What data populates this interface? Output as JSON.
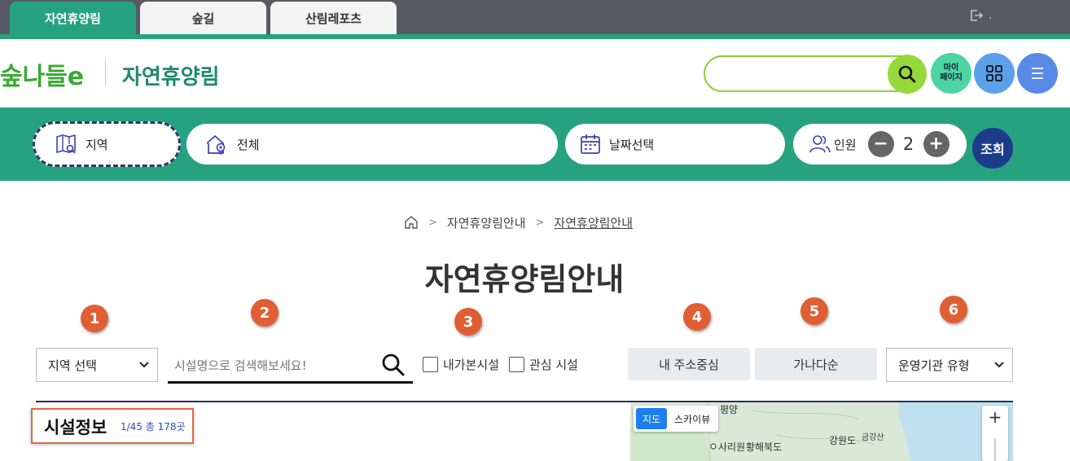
{
  "topbar": {
    "tabs": [
      {
        "label": "자연휴양림",
        "active": true
      },
      {
        "label": "숲길",
        "active": false
      },
      {
        "label": "산림레포츠",
        "active": false
      }
    ],
    "logout_text": "."
  },
  "header": {
    "logo_text": "숲나들e",
    "site_title": "자연휴양림",
    "search_placeholder": "",
    "mypage_line1": "마이",
    "mypage_line2": "페이지"
  },
  "filter": {
    "region_label": "지역",
    "all_label": "전체",
    "date_label": "날짜선택",
    "people_label": "인원",
    "people_count": "2",
    "minus": "−",
    "plus": "+",
    "query_label": "조회"
  },
  "breadcrumb": {
    "items": [
      "자연휴양림안내",
      "자연휴양림안내"
    ]
  },
  "page_title": "자연휴양림안내",
  "markers": [
    "1",
    "2",
    "3",
    "4",
    "5",
    "6"
  ],
  "controls": {
    "region_select": "지역 선택",
    "name_search_placeholder": "시설명으로 검색해보세요!",
    "check_visited": "내가본시설",
    "check_favorite": "관심 시설",
    "sort_address": "내 주소중심",
    "sort_alpha": "가나다순",
    "org_select": "운영기관 유형"
  },
  "facility": {
    "title": "시설정보",
    "count": "1/45 총 178곳"
  },
  "map": {
    "toggle_map": "지도",
    "toggle_sky": "스카이뷰",
    "zoom_in": "+",
    "labels": {
      "pyongyang": "평양",
      "sariwon": "사리원",
      "hwanghae": "황해북도",
      "gangwon": "강원도",
      "geumgang": "금강산"
    }
  },
  "colors": {
    "brand_green": "#27a27f",
    "topbar_gray": "#575a63",
    "marker_orange": "#e05e33",
    "query_navy": "#1c3c8a"
  }
}
